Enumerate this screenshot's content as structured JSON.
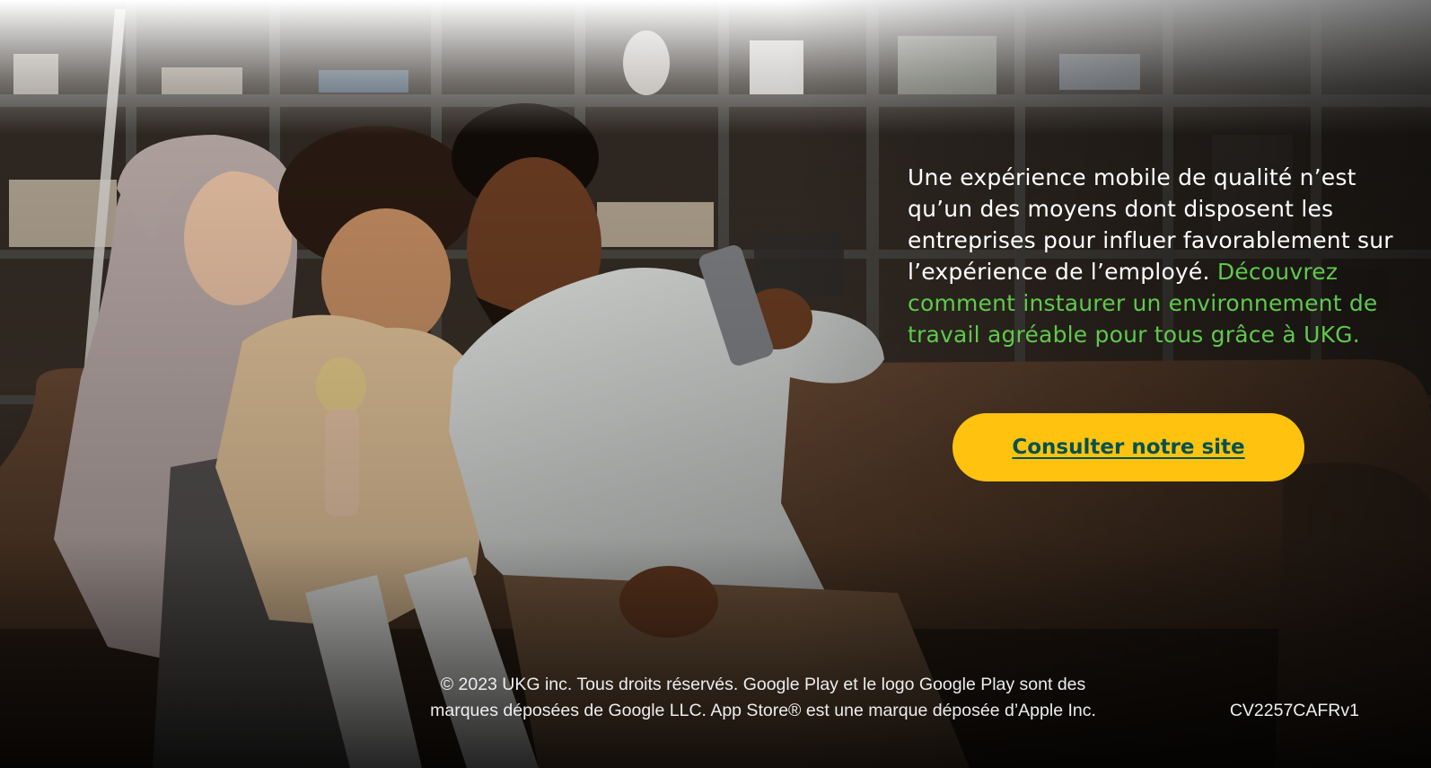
{
  "promo": {
    "body_text": "Une expérience mobile de qualité n’est qu’un des moyens dont disposent les entreprises pour influer favorablement sur l’expérience de l’employé.",
    "highlight_text": "Découvrez comment instaurer un environnement de travail agréable pour tous grâce à UKG.",
    "cta_label": "Consulter notre site"
  },
  "footer": {
    "legal_line_1": "© 2023 UKG inc. Tous droits réservés. Google Play et le logo Google Play sont des",
    "legal_line_2": "marques déposées de Google LLC. App Store® est une marque déposée d’Apple Inc.",
    "code": "CV2257CAFRv1"
  },
  "colors": {
    "body_text": "#ffffff",
    "highlight_text": "#5fc94b",
    "cta_background": "#ffc20e",
    "cta_text": "#005151",
    "footer_text": "#ededed"
  }
}
